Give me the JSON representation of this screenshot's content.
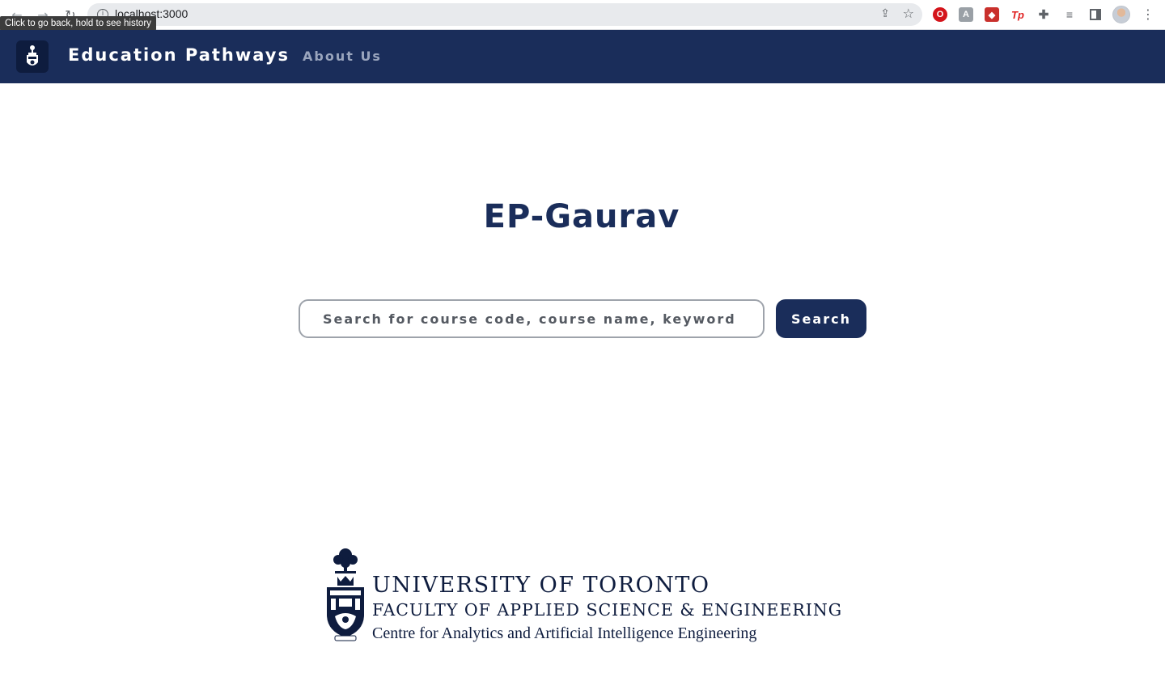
{
  "browser": {
    "url": "localhost:3000",
    "tooltip": "Click to go back, hold to see history",
    "icons": {
      "back": "back-arrow-icon",
      "forward": "forward-arrow-icon",
      "reload": "reload-icon",
      "info": "info-icon",
      "share": "share-icon",
      "bookmark": "star-icon",
      "extensions": [
        "opera-extension-icon",
        "a-extension-icon",
        "red-extension-icon",
        "tp-extension-icon",
        "puzzle-icon",
        "media-icon",
        "sidebar-icon"
      ],
      "profile": "avatar",
      "menu": "kebab-menu-icon"
    },
    "ext_tp_label": "Tp"
  },
  "navbar": {
    "brand": "Education Pathways",
    "about_link": "About Us",
    "background": "#1a2d5a"
  },
  "main": {
    "title": "EP-Gaurav",
    "search": {
      "placeholder": "Search for course code, course name, keyword ...",
      "value": "",
      "button_label": "Search"
    }
  },
  "footer": {
    "line1": "UNIVERSITY OF TORONTO",
    "line2": "FACULTY OF APPLIED SCIENCE & ENGINEERING",
    "line3": "Centre for Analytics and Artificial Intelligence Engineering"
  },
  "colors": {
    "primary": "#1a2d5a",
    "nav_link": "#9aa5bd"
  }
}
